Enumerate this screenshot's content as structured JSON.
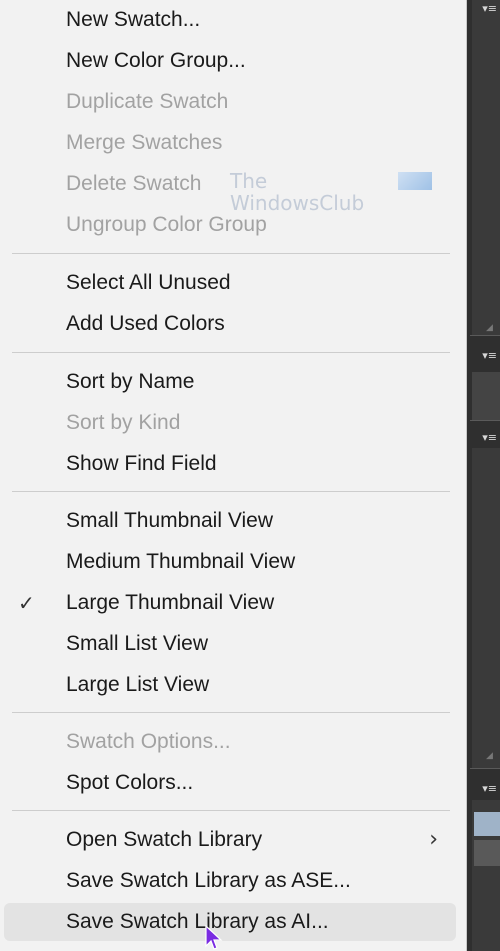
{
  "menu": {
    "groups": [
      {
        "items": [
          {
            "label": "New Swatch...",
            "enabled": true
          },
          {
            "label": "New Color Group...",
            "enabled": true
          },
          {
            "label": "Duplicate Swatch",
            "enabled": false
          },
          {
            "label": "Merge Swatches",
            "enabled": false
          },
          {
            "label": "Delete Swatch",
            "enabled": false
          },
          {
            "label": "Ungroup Color Group",
            "enabled": false
          }
        ]
      },
      {
        "items": [
          {
            "label": "Select All Unused",
            "enabled": true
          },
          {
            "label": "Add Used Colors",
            "enabled": true
          }
        ]
      },
      {
        "items": [
          {
            "label": "Sort by Name",
            "enabled": true
          },
          {
            "label": "Sort by Kind",
            "enabled": false
          },
          {
            "label": "Show Find Field",
            "enabled": true
          }
        ]
      },
      {
        "items": [
          {
            "label": "Small Thumbnail View",
            "enabled": true
          },
          {
            "label": "Medium Thumbnail View",
            "enabled": true
          },
          {
            "label": "Large Thumbnail View",
            "enabled": true,
            "checked": true
          },
          {
            "label": "Small List View",
            "enabled": true
          },
          {
            "label": "Large List View",
            "enabled": true
          }
        ]
      },
      {
        "items": [
          {
            "label": "Swatch Options...",
            "enabled": false
          },
          {
            "label": "Spot Colors...",
            "enabled": true
          }
        ]
      },
      {
        "items": [
          {
            "label": "Open Swatch Library",
            "enabled": true,
            "submenu": true
          },
          {
            "label": "Save Swatch Library as ASE...",
            "enabled": true
          },
          {
            "label": "Save Swatch Library as AI...",
            "enabled": true,
            "hovered": true
          }
        ]
      }
    ],
    "checkmark_glyph": "✓",
    "submenu_glyph": "›"
  },
  "watermark": {
    "line1": "The",
    "line2": "WindowsClub"
  },
  "panel_menu_glyph": "▾≡",
  "colors": {
    "menu_bg": "#f2f2f2",
    "disabled_text": "#a2a2a2",
    "hover_bg": "#e3e3e3",
    "app_bg": "#2f2f2f"
  }
}
